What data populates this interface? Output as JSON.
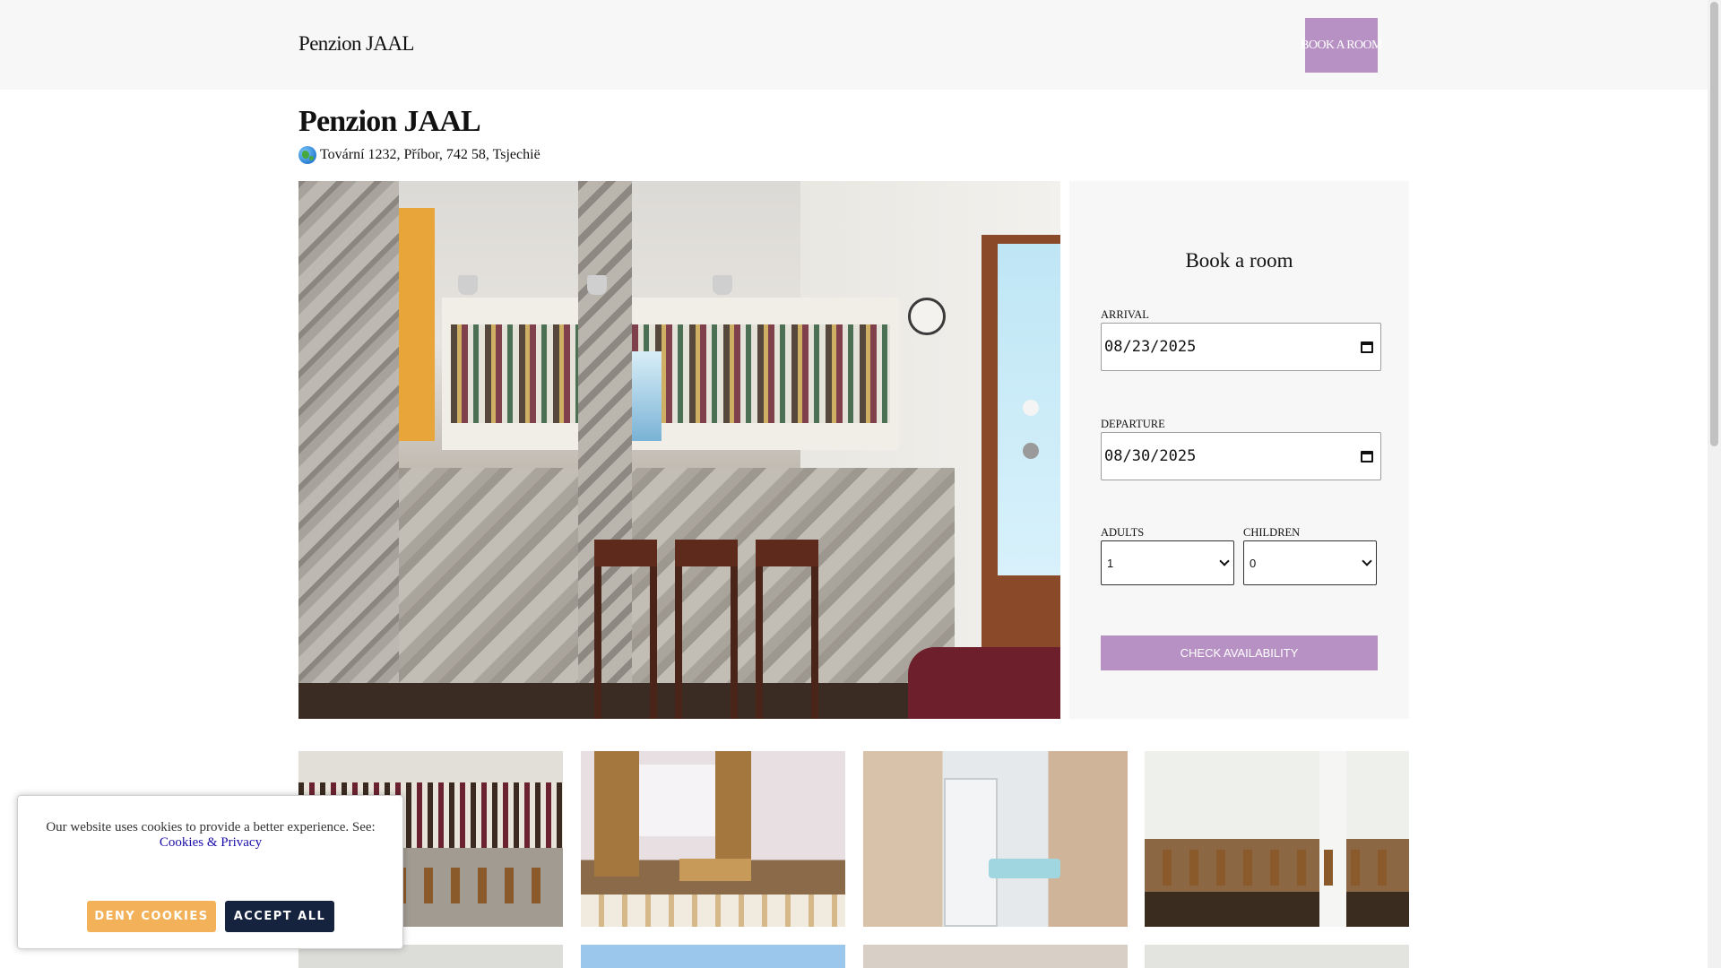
{
  "header": {
    "brand": "Penzion JAAL",
    "book_button": "BOOK A ROOM"
  },
  "property": {
    "title": "Penzion JAAL",
    "address": "Tovární 1232, Příbor, 742 58, Tsjechië",
    "address_icon": "globe-icon"
  },
  "booking": {
    "heading": "Book a room",
    "arrival_label": "ARRIVAL",
    "arrival_value": "08/23/2025",
    "departure_label": "DEPARTURE",
    "departure_value": "08/30/2025",
    "adults_label": "ADULTS",
    "adults_value": "1",
    "children_label": "CHILDREN",
    "children_value": "0",
    "check_button": "CHECK AVAILABILITY"
  },
  "cookies": {
    "message": "Our website uses cookies to provide a better experience. See:",
    "link": "Cookies & Privacy",
    "deny": "DENY COOKIES",
    "accept": "ACCEPT ALL"
  },
  "colors": {
    "accent": "#b791c4",
    "deny": "#f3b25a",
    "accept": "#16233f",
    "header_bg": "#f7f7f7"
  }
}
